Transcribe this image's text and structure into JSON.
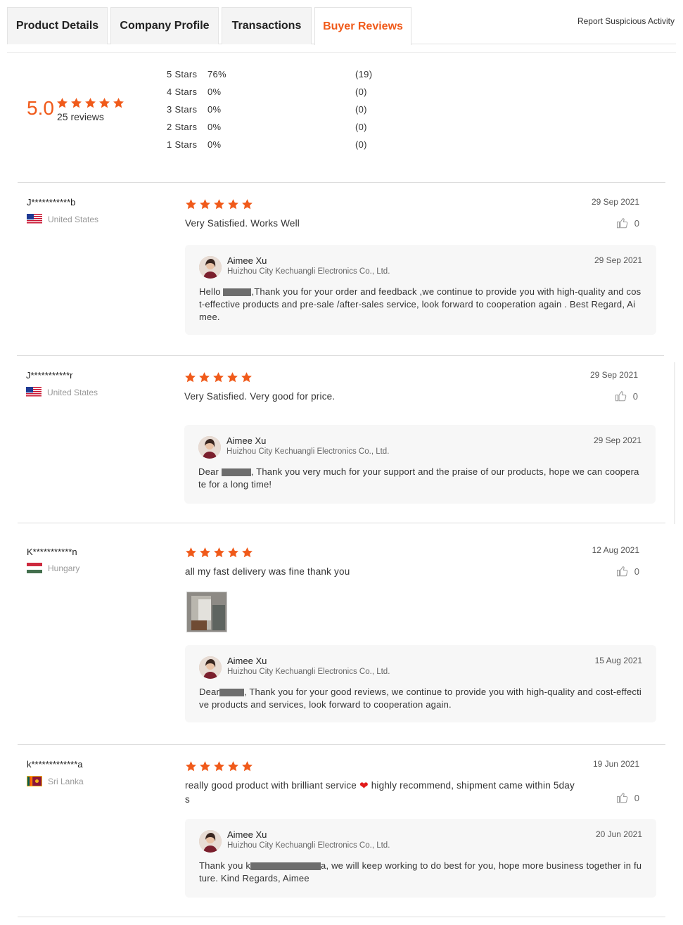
{
  "tabs": [
    {
      "label": "Product Details",
      "active": false
    },
    {
      "label": "Company Profile",
      "active": false
    },
    {
      "label": "Transactions",
      "active": false
    },
    {
      "label": "Buyer Reviews",
      "active": true
    }
  ],
  "report_link": "Report Suspicious Activity",
  "summary": {
    "score": "5.0",
    "stars": 5,
    "review_count": "25 reviews",
    "distribution": [
      {
        "label": "5 Stars",
        "percent": "76%",
        "count": "(19)"
      },
      {
        "label": "4 Stars",
        "percent": "0%",
        "count": "(0)"
      },
      {
        "label": "3 Stars",
        "percent": "0%",
        "count": "(0)"
      },
      {
        "label": "2 Stars",
        "percent": "0%",
        "count": "(0)"
      },
      {
        "label": "1 Stars",
        "percent": "0%",
        "count": "(0)"
      }
    ]
  },
  "colors": {
    "accent": "#f05a1a",
    "star": "#f05a1a"
  },
  "reviews": [
    {
      "reviewer": "J***********b",
      "country": "United States",
      "flag_icon": "us-flag-icon",
      "rating": 5,
      "date": "29 Sep 2021",
      "text": "Very Satisfied. Works Well",
      "likes": "0",
      "reply": {
        "name": "Aimee Xu",
        "company": "Huizhou City Kechuangli Electronics Co., Ltd.",
        "date": "29 Sep 2021",
        "before": "Hello ",
        "after": ",Thank you for your order and feedback ,we continue to provide you with high-quality and cost-effective products and  pre-sale /after-sales service, look forward to cooperation again . Best Regard, Aimee."
      }
    },
    {
      "reviewer": "J***********r",
      "country": "United States",
      "flag_icon": "us-flag-icon",
      "rating": 5,
      "date": "29 Sep 2021",
      "text": "Very Satisfied. Very good for price.",
      "likes": "0",
      "reply": {
        "name": "Aimee Xu",
        "company": "Huizhou City Kechuangli Electronics Co., Ltd.",
        "date": "29 Sep 2021",
        "before": "Dear ",
        "after": ", Thank you very much for your support and the praise of our products, hope we can cooperate for a long time!"
      }
    },
    {
      "reviewer": "K***********n",
      "country": "Hungary",
      "flag_icon": "hungary-flag-icon",
      "rating": 5,
      "date": "12 Aug 2021",
      "text": "all my fast delivery was fine thank you",
      "likes": "0",
      "reply": {
        "name": "Aimee Xu",
        "company": "Huizhou City Kechuangli Electronics Co., Ltd.",
        "date": "15 Aug 2021",
        "before": "Dear",
        "after": ", Thank you for your good reviews, we continue to provide you with high-quality and cost-effective products and services, look forward to cooperation again."
      }
    },
    {
      "reviewer": "k*************a",
      "country": "Sri Lanka",
      "flag_icon": "sri-lanka-flag-icon",
      "rating": 5,
      "date": "19 Jun 2021",
      "text_before": "really good product with brilliant service ",
      "text_after": " highly recommend, shipment came within 5days",
      "likes": "0",
      "reply": {
        "name": "Aimee Xu",
        "company": "Huizhou City Kechuangli Electronics Co., Ltd.",
        "date": "20 Jun 2021",
        "before": "Thank you k",
        "after": "a, we will keep working to do best for you, hope more business together in future. Kind Regards, Aimee"
      }
    }
  ]
}
